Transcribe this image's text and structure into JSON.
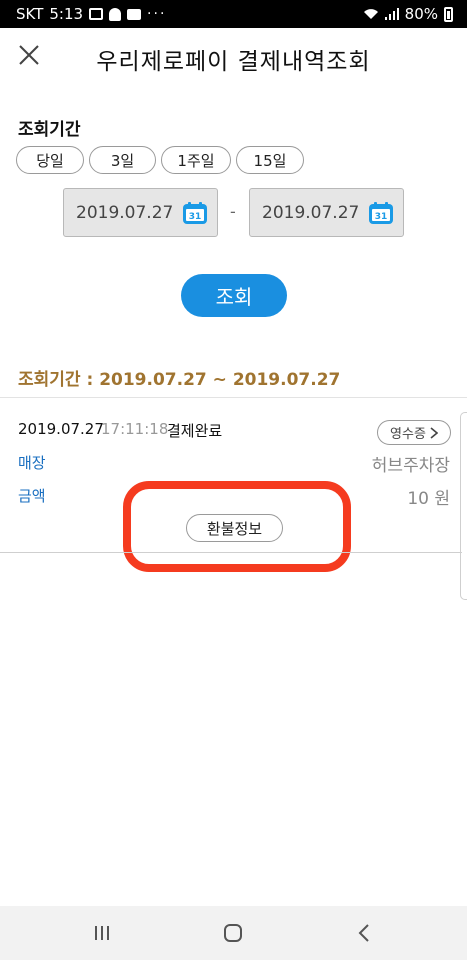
{
  "status_bar": {
    "carrier": "SKT",
    "time": "5:13",
    "overflow": "···",
    "battery": "80%",
    "icons": [
      "image-icon",
      "bell-icon",
      "message-icon",
      "wifi-icon",
      "signal-icon",
      "battery-icon"
    ]
  },
  "header": {
    "title": "우리제로페이 결제내역조회",
    "close_icon": "close-icon"
  },
  "period": {
    "label": "조회기간",
    "chips": [
      "당일",
      "3일",
      "1주일",
      "15일"
    ],
    "from_date": "2019.07.27",
    "to_date": "2019.07.27",
    "separator": "-",
    "calendar_day": "31"
  },
  "search_button": "조회",
  "result_period": "조회기간 : 2019.07.27 ~ 2019.07.27",
  "transaction": {
    "date": "2019.07.27",
    "time": "17:11:18",
    "status": "결제완료",
    "receipt_label": "영수증",
    "store_label": "매장",
    "store_value": "허브주차장",
    "amount_label": "금액",
    "amount_value": "10 원",
    "refund_label": "환불정보"
  },
  "colors": {
    "accent": "#1a8fe0",
    "period_text": "#a07430",
    "field_label": "#1a6fc0",
    "highlight": "#f53b1f"
  },
  "nav_bar": [
    "recent-apps-icon",
    "home-icon",
    "back-icon"
  ]
}
